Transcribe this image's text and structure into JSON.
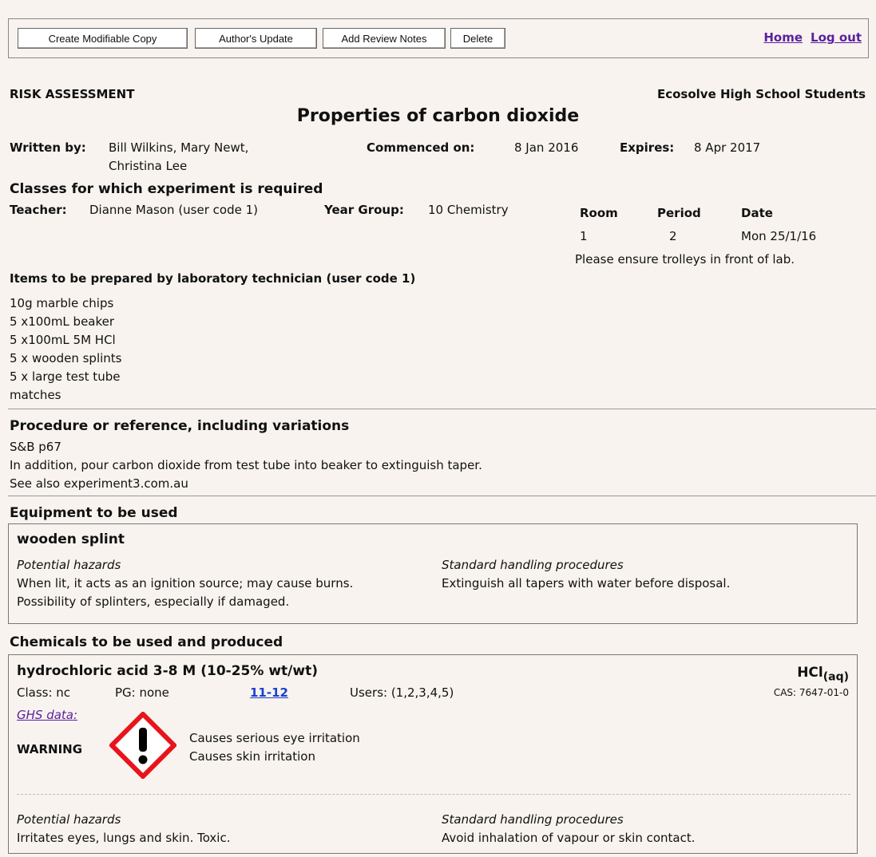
{
  "toolbar": {
    "buttons": [
      "Create Modifiable Copy",
      "Author's Update",
      "Add Review Notes",
      "Delete"
    ],
    "links": [
      "Home",
      "Log out"
    ]
  },
  "header": {
    "doc_type": "RISK ASSESSMENT",
    "org": "Ecosolve High School Students",
    "title": "Properties of carbon dioxide"
  },
  "meta": {
    "written_by_label": "Written by:",
    "written_by_line1": "Bill Wilkins, Mary Newt,",
    "written_by_line2": "Christina Lee",
    "commenced_label": "Commenced on:",
    "commenced_value": "8 Jan 2016",
    "expires_label": "Expires:",
    "expires_value": "8 Apr 2017"
  },
  "classes": {
    "heading": "Classes for which experiment is required",
    "teacher_label": "Teacher:",
    "teacher_value": "Dianne Mason (user code 1)",
    "year_label": "Year Group:",
    "year_value": "10 Chemistry",
    "room_header": "Room",
    "period_header": "Period",
    "date_header": "Date",
    "room": "1",
    "period": "2",
    "date": "Mon 25/1/16",
    "note": "Please ensure trolleys in front of lab."
  },
  "items": {
    "heading": "Items to be prepared by laboratory technician (user code 1)",
    "list": [
      "10g marble chips",
      "5 x100mL beaker",
      "5 x100mL 5M HCl",
      "5 x wooden splints",
      "5 x large test tube",
      "matches"
    ]
  },
  "procedure": {
    "heading": "Procedure or reference, including variations",
    "lines": [
      "S&B p67",
      "In addition, pour carbon dioxide from test tube into beaker to extinguish taper.",
      "See also experiment3.com.au"
    ]
  },
  "equipment": {
    "heading": "Equipment to be used",
    "name": "wooden splint",
    "hazards_label": "Potential hazards",
    "hazards": [
      "When lit, it acts as an ignition source; may cause burns.",
      "Possibility of splinters, especially if damaged."
    ],
    "handling_label": "Standard handling procedures",
    "handling": [
      "Extinguish all tapers with water before disposal."
    ]
  },
  "chemicals": {
    "heading": "Chemicals to be used and produced",
    "name": "hydrochloric acid 3-8 M (10-25% wt/wt)",
    "formula": "HCl",
    "formula_sub": "(aq)",
    "class": "Class: nc",
    "pg": "PG: none",
    "link": "11-12",
    "users": "Users: (1,2,3,4,5)",
    "cas": "CAS: 7647-01-0",
    "ghs_label": "GHS data:",
    "signal": "WARNING",
    "ghs_statements": [
      "Causes serious eye irritation",
      "Causes skin irritation"
    ],
    "hazards_label": "Potential hazards",
    "hazards": [
      "Irritates eyes, lungs and skin. Toxic."
    ],
    "handling_label": "Standard handling procedures",
    "handling": [
      "Avoid inhalation of vapour or skin contact."
    ],
    "pictogram_icon": "exclamation-mark-icon",
    "pictogram_color": "#e8141c"
  }
}
